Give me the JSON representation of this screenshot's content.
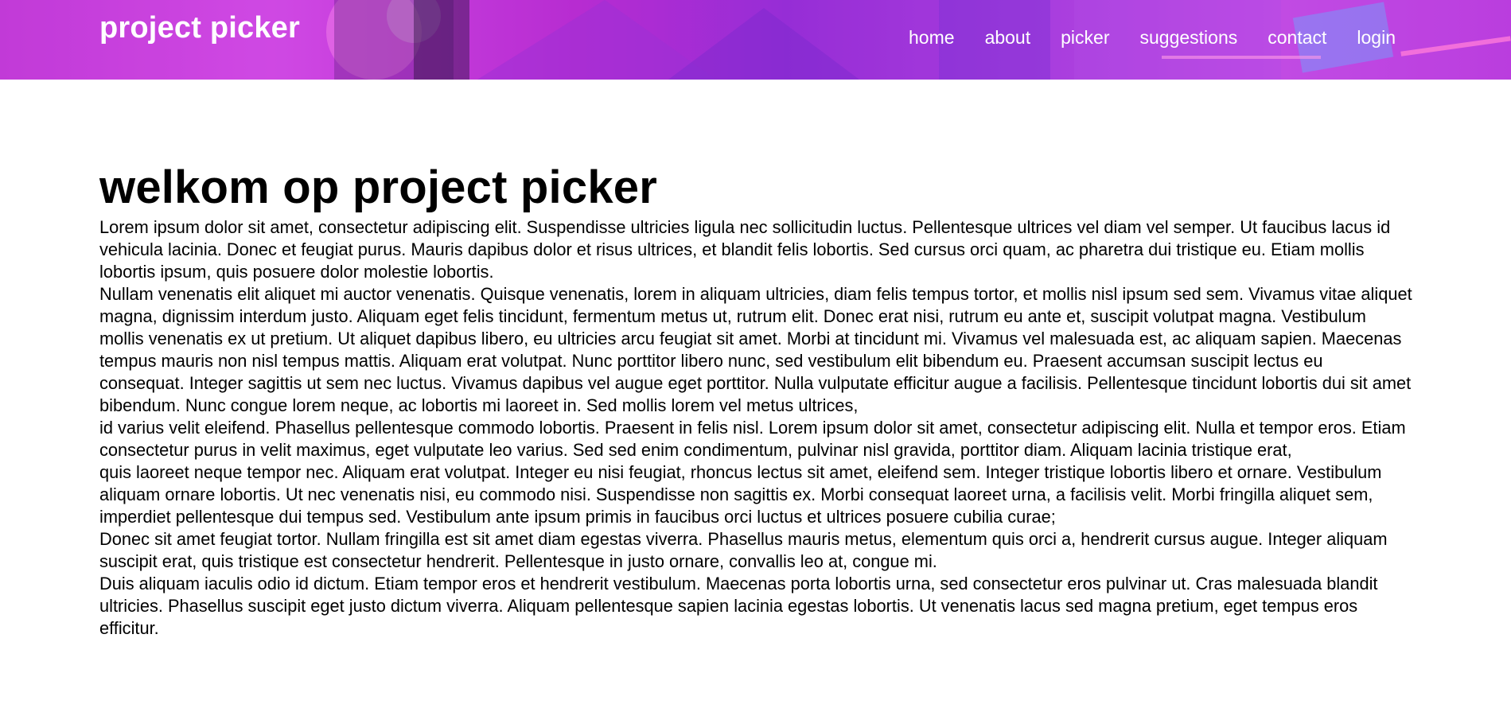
{
  "header": {
    "brand": "project picker",
    "nav": [
      {
        "label": "home"
      },
      {
        "label": "about"
      },
      {
        "label": "picker"
      },
      {
        "label": "suggestions"
      },
      {
        "label": "contact"
      },
      {
        "label": "login"
      }
    ],
    "colors": {
      "banner_primary": "#c13ad8",
      "banner_secondary": "#8f2bd6",
      "nav_text": "#ffffff"
    }
  },
  "main": {
    "title": "welkom op project picker",
    "paragraphs": [
      "Lorem ipsum dolor sit amet, consectetur adipiscing elit. Suspendisse ultricies ligula nec sollicitudin luctus. Pellentesque ultrices vel diam vel semper. Ut faucibus lacus id vehicula lacinia. Donec et feugiat purus. Mauris dapibus dolor et risus ultrices, et blandit felis lobortis. Sed cursus orci quam, ac pharetra dui tristique eu. Etiam mollis lobortis ipsum, quis posuere dolor molestie lobortis.",
      "Nullam venenatis elit aliquet mi auctor venenatis. Quisque venenatis, lorem in aliquam ultricies, diam felis tempus tortor, et mollis nisl ipsum sed sem. Vivamus vitae aliquet magna, dignissim interdum justo. Aliquam eget felis tincidunt, fermentum metus ut, rutrum elit. Donec erat nisi, rutrum eu ante et, suscipit volutpat magna. Vestibulum mollis venenatis ex ut pretium. Ut aliquet dapibus libero, eu ultricies arcu feugiat sit amet. Morbi at tincidunt mi. Vivamus vel malesuada est, ac aliquam sapien. Maecenas tempus mauris non nisl tempus mattis. Aliquam erat volutpat. Nunc porttitor libero nunc, sed vestibulum elit bibendum eu. Praesent accumsan suscipit lectus eu consequat. Integer sagittis ut sem nec luctus. Vivamus dapibus vel augue eget porttitor. Nulla vulputate efficitur augue a facilisis. Pellentesque tincidunt lobortis dui sit amet bibendum. Nunc congue lorem neque, ac lobortis mi laoreet in. Sed mollis lorem vel metus ultrices,",
      "id varius velit eleifend. Phasellus pellentesque commodo lobortis. Praesent in felis nisl. Lorem ipsum dolor sit amet, consectetur adipiscing elit. Nulla et tempor eros. Etiam consectetur purus in velit maximus, eget vulputate leo varius. Sed sed enim condimentum, pulvinar nisl gravida, porttitor diam. Aliquam lacinia tristique erat,",
      "quis laoreet neque tempor nec. Aliquam erat volutpat. Integer eu nisi feugiat, rhoncus lectus sit amet, eleifend sem. Integer tristique lobortis libero et ornare. Vestibulum aliquam ornare lobortis. Ut nec venenatis nisi, eu commodo nisi. Suspendisse non sagittis ex. Morbi consequat laoreet urna, a facilisis velit. Morbi fringilla aliquet sem, imperdiet pellentesque dui tempus sed. Vestibulum ante ipsum primis in faucibus orci luctus et ultrices posuere cubilia curae;",
      "Donec sit amet feugiat tortor. Nullam fringilla est sit amet diam egestas viverra. Phasellus mauris metus, elementum quis orci a, hendrerit cursus augue. Integer aliquam suscipit erat, quis tristique est consectetur hendrerit. Pellentesque in justo ornare, convallis leo at, congue mi.",
      "Duis aliquam iaculis odio id dictum. Etiam tempor eros et hendrerit vestibulum. Maecenas porta lobortis urna, sed consectetur eros pulvinar ut. Cras malesuada blandit ultricies. Phasellus suscipit eget justo dictum viverra. Aliquam pellentesque sapien lacinia egestas lobortis. Ut venenatis lacus sed magna pretium, eget tempus eros efficitur."
    ]
  }
}
